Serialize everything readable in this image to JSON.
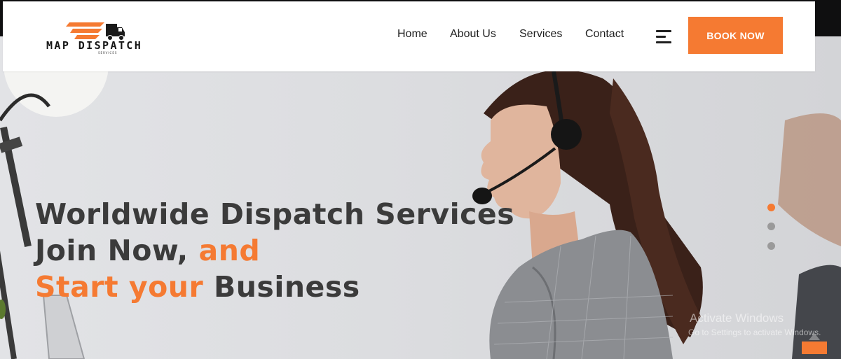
{
  "brand": {
    "name": "MAP DISPATCH",
    "tagline": "SERVICES",
    "logo_icon": "truck-icon"
  },
  "nav": {
    "items": [
      {
        "label": "Home"
      },
      {
        "label": "About Us"
      },
      {
        "label": "Services"
      },
      {
        "label": "Contact"
      }
    ],
    "menu_icon": "hamburger-menu-icon",
    "book_label": "BOOK NOW"
  },
  "hero": {
    "line1": "Worldwide Dispatch Services",
    "line2_dark": "Join Now, ",
    "line2_accent": "and",
    "line3_accent": "Start your",
    "line3_dark": " Business",
    "slides": {
      "count": 3,
      "active": 1
    }
  },
  "watermark": {
    "title": "Activate Windows",
    "subtitle": "Go to Settings to activate Windows."
  },
  "colors": {
    "accent": "#f57a32",
    "text_dark": "#3b3b3b",
    "dot_inactive": "#9a9a9a"
  }
}
